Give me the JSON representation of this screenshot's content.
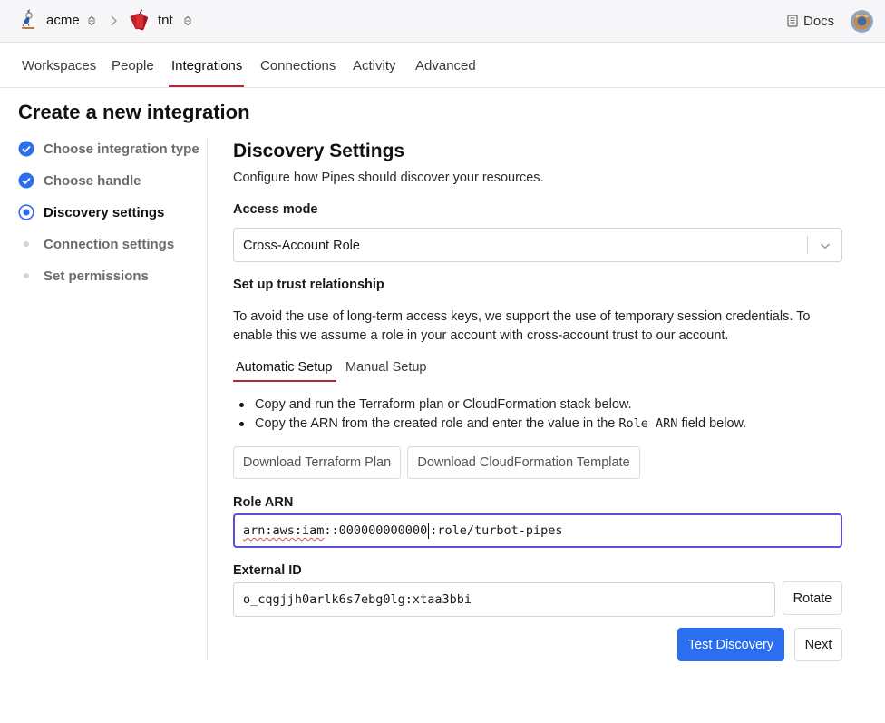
{
  "topbar": {
    "org_name": "acme",
    "workspace_name": "tnt",
    "docs_label": "Docs",
    "icons": {
      "org_logo": "bird-logo-icon",
      "org_switcher": "updown-chevron-icon",
      "breadcrumb_sep": "chevron-right-icon",
      "workspace_logo": "dynamite-logo-icon",
      "docs": "book-icon",
      "avatar": "user-avatar"
    }
  },
  "nav": {
    "tabs": [
      {
        "label": "Workspaces"
      },
      {
        "label": "People"
      },
      {
        "label": "Integrations",
        "active": true
      },
      {
        "label": "Connections"
      },
      {
        "label": "Activity"
      },
      {
        "label": "Advanced"
      }
    ]
  },
  "page": {
    "title": "Create a new integration"
  },
  "steps": [
    {
      "label": "Choose integration type",
      "state": "complete"
    },
    {
      "label": "Choose handle",
      "state": "complete"
    },
    {
      "label": "Discovery settings",
      "state": "current"
    },
    {
      "label": "Connection settings",
      "state": "pending"
    },
    {
      "label": "Set permissions",
      "state": "pending"
    }
  ],
  "discovery": {
    "title": "Discovery Settings",
    "subtitle": "Configure how Pipes should discover your resources.",
    "access_mode_label": "Access mode",
    "access_mode_value": "Cross-Account Role",
    "trust_label": "Set up trust relationship",
    "trust_text": "To avoid the use of long-term access keys, we support the use of temporary session credentials. To enable this we assume a role in your account with cross-account trust to our account.",
    "setup_tabs": [
      {
        "label": "Automatic Setup",
        "active": true
      },
      {
        "label": "Manual Setup"
      }
    ],
    "instructions": {
      "line1": "Copy and run the Terraform plan or CloudFormation stack below.",
      "line2_before": "Copy the ARN from the created role and enter the value in the ",
      "line2_code": "Role ARN",
      "line2_after": " field below."
    },
    "download_terraform_label": "Download Terraform Plan",
    "download_cloudformation_label": "Download CloudFormation Template",
    "role_arn_label": "Role ARN",
    "role_arn_value_part1": "arn:aws:iam",
    "role_arn_value_part2": "::000000000000",
    "role_arn_value_part3": ":role/turbot-pipes",
    "external_id_label": "External ID",
    "external_id_value": "o_cqgjjh0arlk6s7ebg0lg:xtaa3bbi",
    "rotate_label": "Rotate",
    "test_discovery_label": "Test Discovery",
    "next_label": "Next"
  },
  "colors": {
    "accent_underline": "#b0263e",
    "primary_button": "#2b6ef0",
    "step_complete": "#2b6ef0",
    "focus_ring": "#5b4ed8"
  }
}
